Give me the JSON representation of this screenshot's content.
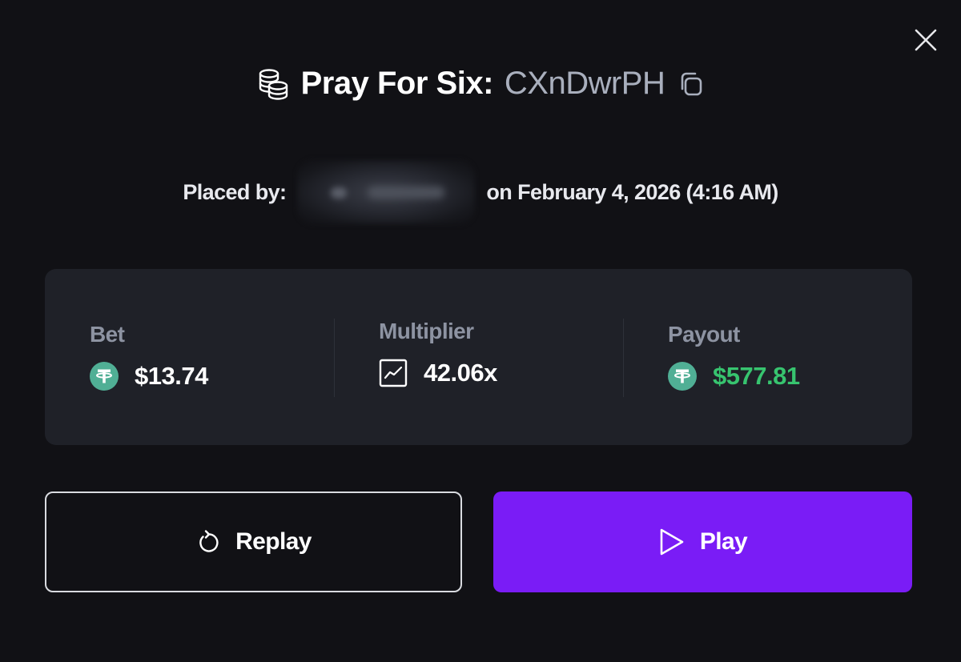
{
  "modal": {
    "title": "Pray For Six:",
    "game_id": "CXnDwrPH",
    "icons": {
      "title": "coins-stack-icon",
      "copy": "copy-icon",
      "close": "close-icon"
    }
  },
  "placement": {
    "label": "Placed by:",
    "date_text": "on February 4, 2026 (4:16 AM)"
  },
  "stats": {
    "bet": {
      "label": "Bet",
      "value": "$13.74",
      "icon": "tether-icon"
    },
    "multiplier": {
      "label": "Multiplier",
      "value": "42.06x",
      "icon": "chart-line-icon"
    },
    "payout": {
      "label": "Payout",
      "value": "$577.81",
      "icon": "tether-icon"
    }
  },
  "buttons": {
    "replay_label": "Replay",
    "play_label": "Play"
  },
  "colors": {
    "background": "#111115",
    "card": "#1f2128",
    "accent_purple": "#7a1cf6",
    "payout_green": "#37c46f",
    "tether_green": "#50af95",
    "muted_text": "#8d93a2"
  }
}
